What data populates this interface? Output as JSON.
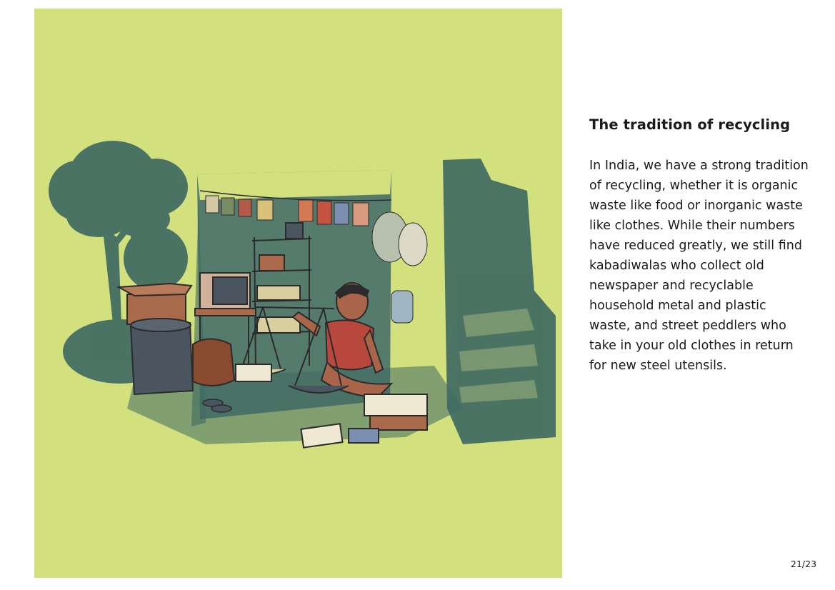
{
  "page": {
    "title": "The tradition of recycling",
    "body": "In India, we have a strong tradition of recycling, whether it is organic waste like food or inorganic waste like clothes. While their numbers have reduced greatly, we still find kabadiwalas who collect old newspaper and recyclable household metal and plastic waste, and street peddlers who take in your old clothes in return for new steel utensils.",
    "page_number": "21/23"
  },
  "illustration": {
    "subject": "kabadiwala seated in a small recycling shop weighing paper on a hand scale",
    "colors": {
      "background": "#d3e07e",
      "foliage": "#3f6a62",
      "skin": "#a8654a",
      "shirt": "#b8473d",
      "box": "#a86a4a",
      "bin": "#4a5560"
    }
  }
}
